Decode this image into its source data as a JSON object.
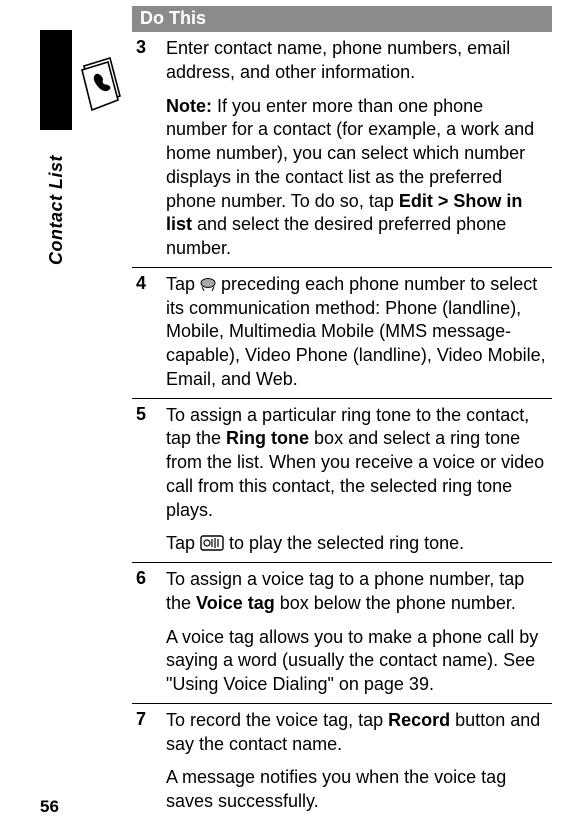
{
  "page_number": "56",
  "tab_label": "Contact List",
  "header": "Do This",
  "steps": [
    {
      "num": "3",
      "intro": "Enter contact name, phone numbers, email address, and other information.",
      "note_label": "Note:",
      "note_before": " If you enter more than one phone number for a contact (for example, a work and home number), you can select which number displays in the contact list as the preferred phone number. To do so, tap ",
      "note_bold": "Edit > Show in list",
      "note_after": " and select the desired preferred phone number."
    },
    {
      "num": "4",
      "before": "Tap ",
      "after": " preceding each phone number to select its communication method: Phone (landline), Mobile, Multimedia Mobile (MMS message-capable), Video Phone (landline), Video Mobile, Email, and Web."
    },
    {
      "num": "5",
      "p1_before": "To assign a particular ring tone to the contact, tap the ",
      "p1_bold": "Ring tone",
      "p1_after": " box and select a ring tone from the list. When you receive a voice or video call from this contact, the selected ring tone plays.",
      "p2_before": "Tap ",
      "p2_after": " to play the selected ring tone."
    },
    {
      "num": "6",
      "p1_before": "To assign a voice tag to a phone number, tap the ",
      "p1_bold": "Voice tag",
      "p1_after": " box below the phone number.",
      "p2": "A voice tag allows you to make a phone call by saying a word (usually the contact name). See \"Using Voice Dialing\" on page 39."
    },
    {
      "num": "7",
      "p1_before": "To record the voice tag, tap ",
      "p1_bold": "Record",
      "p1_after": " button and say the contact name.",
      "p2": "A message notifies you when the voice tag saves successfully."
    }
  ]
}
